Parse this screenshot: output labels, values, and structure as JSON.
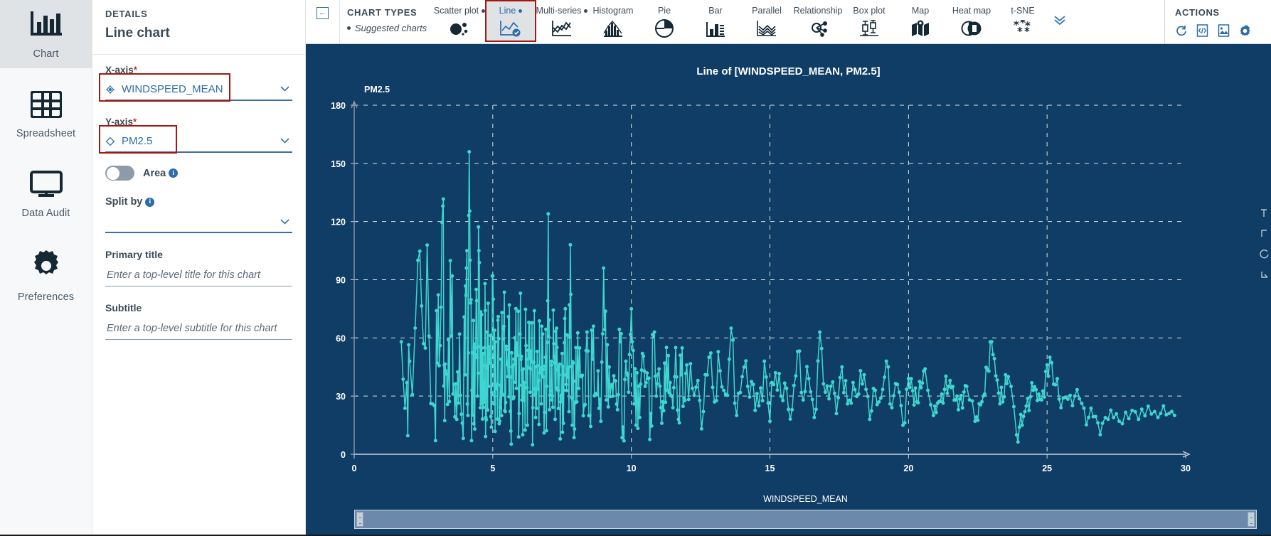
{
  "rail": {
    "items": [
      {
        "label": "Chart",
        "icon": "bar-chart-icon",
        "active": true
      },
      {
        "label": "Spreadsheet",
        "icon": "table-grid-icon",
        "active": false
      },
      {
        "label": "Data Audit",
        "icon": "monitor-icon",
        "active": false
      },
      {
        "label": "Preferences",
        "icon": "gear-icon",
        "active": false
      }
    ]
  },
  "details": {
    "kicker": "DETAILS",
    "title": "Line chart",
    "x_axis": {
      "label": "X-axis",
      "required": "*",
      "value": "WINDSPEED_MEAN",
      "icon": "categorical-field-icon",
      "highlighted": true
    },
    "y_axis": {
      "label": "Y-axis",
      "required": "*",
      "value": "PM2.5",
      "icon": "continuous-field-icon",
      "highlighted": true
    },
    "area_toggle": {
      "label": "Area",
      "state": "off",
      "info": "info-icon"
    },
    "split_by": {
      "label": "Split by",
      "value": "",
      "info": "info-icon"
    },
    "primary_title": {
      "label": "Primary title",
      "value": "",
      "placeholder": "Enter a top-level title for this chart"
    },
    "subtitle": {
      "label": "Subtitle",
      "value": "",
      "placeholder": "Enter a top-level subtitle for this chart"
    }
  },
  "topbar": {
    "collapse_icon": "collapse-panel-icon",
    "chart_types_title": "CHART TYPES",
    "suggested_label": "Suggested charts",
    "overflow_icon": "chevron-double-down-icon",
    "types": [
      {
        "label": "Scatter plot",
        "icon": "scatter-plot-icon",
        "suggested": true,
        "selected": false
      },
      {
        "label": "Line",
        "icon": "line-chart-icon",
        "suggested": true,
        "selected": true
      },
      {
        "label": "Multi-series",
        "icon": "multi-series-icon",
        "suggested": true,
        "selected": false
      },
      {
        "label": "Histogram",
        "icon": "histogram-icon",
        "suggested": false,
        "selected": false
      },
      {
        "label": "Pie",
        "icon": "pie-chart-icon",
        "suggested": false,
        "selected": false
      },
      {
        "label": "Bar",
        "icon": "bar-chart-icon",
        "suggested": false,
        "selected": false
      },
      {
        "label": "Parallel",
        "icon": "parallel-icon",
        "suggested": false,
        "selected": false
      },
      {
        "label": "Relationship",
        "icon": "relationship-icon",
        "suggested": false,
        "selected": false
      },
      {
        "label": "Box plot",
        "icon": "box-plot-icon",
        "suggested": false,
        "selected": false
      },
      {
        "label": "Map",
        "icon": "map-icon",
        "suggested": false,
        "selected": false
      },
      {
        "label": "Heat map",
        "icon": "heat-map-icon",
        "suggested": false,
        "selected": false
      },
      {
        "label": "t-SNE",
        "icon": "tsne-icon",
        "suggested": false,
        "selected": false
      }
    ],
    "actions": {
      "title": "ACTIONS",
      "icons": [
        {
          "name": "refresh-icon"
        },
        {
          "name": "export-code-icon"
        },
        {
          "name": "export-image-icon"
        },
        {
          "name": "settings-gear-icon"
        }
      ]
    }
  },
  "colors": {
    "chart_background": "#103d65",
    "series": "#3dd6d0",
    "accent_blue": "#2d6ca8",
    "highlight_red": "#a5160f",
    "rail_active": "#dfe3e6"
  },
  "chart_data": {
    "type": "line",
    "title": "Line of [WINDSPEED_MEAN, PM2.5]",
    "xlabel": "WINDSPEED_MEAN",
    "ylabel": "PM2.5",
    "xlim": [
      0,
      30
    ],
    "ylim": [
      0,
      180
    ],
    "xticks": [
      0,
      5,
      10,
      15,
      20,
      25,
      30
    ],
    "yticks": [
      0,
      30,
      60,
      90,
      120,
      150,
      180
    ],
    "grid": true,
    "legend": "none",
    "marker": "circle",
    "series": [
      {
        "name": "PM2.5",
        "color": "#3dd6d0",
        "points": [
          [
            1.7,
            58
          ],
          [
            1.9,
            37
          ],
          [
            2.0,
            48
          ],
          [
            2.3,
            100
          ],
          [
            2.5,
            57
          ],
          [
            2.7,
            61
          ],
          [
            2.9,
            25
          ],
          [
            3.0,
            47
          ],
          [
            3.1,
            56
          ],
          [
            3.2,
            128
          ],
          [
            3.25,
            46
          ],
          [
            3.3,
            43
          ],
          [
            3.4,
            59
          ],
          [
            3.5,
            61
          ],
          [
            3.6,
            36
          ],
          [
            3.7,
            18
          ],
          [
            3.8,
            62
          ],
          [
            3.9,
            16
          ],
          [
            4.0,
            41
          ],
          [
            4.05,
            96
          ],
          [
            4.1,
            20
          ],
          [
            4.15,
            156
          ],
          [
            4.2,
            78
          ],
          [
            4.25,
            33
          ],
          [
            4.3,
            69
          ],
          [
            4.35,
            13
          ],
          [
            4.4,
            85
          ],
          [
            4.45,
            30
          ],
          [
            4.5,
            105
          ],
          [
            4.55,
            24
          ],
          [
            4.6,
            72
          ],
          [
            4.62,
            38
          ],
          [
            4.65,
            52
          ],
          [
            4.7,
            27
          ],
          [
            4.72,
            88
          ],
          [
            4.75,
            19
          ],
          [
            4.8,
            63
          ],
          [
            4.85,
            35
          ],
          [
            4.9,
            47
          ],
          [
            4.95,
            14
          ],
          [
            5.0,
            92
          ],
          [
            5.05,
            26
          ],
          [
            5.1,
            58
          ],
          [
            5.15,
            36
          ],
          [
            5.2,
            71
          ],
          [
            5.25,
            17
          ],
          [
            5.3,
            49
          ],
          [
            5.35,
            31
          ],
          [
            5.4,
            66
          ],
          [
            5.45,
            22
          ],
          [
            5.5,
            54
          ],
          [
            5.55,
            40
          ],
          [
            5.6,
            77
          ],
          [
            5.65,
            12
          ],
          [
            5.7,
            45
          ],
          [
            5.75,
            29
          ],
          [
            5.8,
            60
          ],
          [
            5.85,
            34
          ],
          [
            5.9,
            51
          ],
          [
            5.95,
            21
          ],
          [
            6.0,
            83
          ],
          [
            6.05,
            28
          ],
          [
            6.1,
            44
          ],
          [
            6.15,
            37
          ],
          [
            6.2,
            56
          ],
          [
            6.25,
            15
          ],
          [
            6.3,
            68
          ],
          [
            6.35,
            32
          ],
          [
            6.4,
            48
          ],
          [
            6.45,
            24
          ],
          [
            6.5,
            74
          ],
          [
            6.55,
            19
          ],
          [
            6.6,
            53
          ],
          [
            6.65,
            38
          ],
          [
            6.7,
            42
          ],
          [
            6.75,
            26
          ],
          [
            6.8,
            62
          ],
          [
            6.85,
            11
          ],
          [
            6.9,
            50
          ],
          [
            6.95,
            35
          ],
          [
            7.0,
            124
          ],
          [
            7.05,
            23
          ],
          [
            7.1,
            46
          ],
          [
            7.15,
            30
          ],
          [
            7.2,
            57
          ],
          [
            7.25,
            18
          ],
          [
            7.3,
            65
          ],
          [
            7.35,
            33
          ],
          [
            7.4,
            41
          ],
          [
            7.45,
            27
          ],
          [
            7.5,
            52
          ],
          [
            7.55,
            16
          ],
          [
            7.6,
            70
          ],
          [
            7.65,
            36
          ],
          [
            7.7,
            44
          ],
          [
            7.75,
            22
          ],
          [
            7.8,
            108
          ],
          [
            7.85,
            29
          ],
          [
            7.9,
            47
          ],
          [
            7.95,
            13
          ],
          [
            8.0,
            55
          ],
          [
            8.1,
            34
          ],
          [
            8.2,
            40
          ],
          [
            8.3,
            25
          ],
          [
            8.4,
            63
          ],
          [
            8.5,
            20
          ],
          [
            8.6,
            49
          ],
          [
            8.7,
            31
          ],
          [
            8.8,
            43
          ],
          [
            8.9,
            17
          ],
          [
            9.0,
            96
          ],
          [
            9.1,
            28
          ],
          [
            9.2,
            45
          ],
          [
            9.3,
            36
          ],
          [
            9.4,
            38
          ],
          [
            9.5,
            23
          ],
          [
            9.6,
            58
          ],
          [
            9.7,
            14
          ],
          [
            9.8,
            48
          ],
          [
            9.9,
            32
          ],
          [
            10.0,
            75
          ],
          [
            10.1,
            26
          ],
          [
            10.2,
            42
          ],
          [
            10.3,
            19
          ],
          [
            10.4,
            52
          ],
          [
            10.5,
            35
          ],
          [
            10.6,
            39
          ],
          [
            10.7,
            21
          ],
          [
            10.8,
            61
          ],
          [
            10.9,
            30
          ],
          [
            11.0,
            44
          ],
          [
            11.1,
            16
          ],
          [
            11.2,
            47
          ],
          [
            11.3,
            33
          ],
          [
            11.4,
            37
          ],
          [
            11.5,
            24
          ],
          [
            11.6,
            55
          ],
          [
            11.7,
            18
          ],
          [
            11.8,
            41
          ],
          [
            11.9,
            29
          ],
          [
            12.0,
            46
          ],
          [
            12.2,
            34
          ],
          [
            12.4,
            38
          ],
          [
            12.6,
            22
          ],
          [
            12.8,
            50
          ],
          [
            13.0,
            27
          ],
          [
            13.2,
            43
          ],
          [
            13.4,
            31
          ],
          [
            13.6,
            65
          ],
          [
            13.8,
            20
          ],
          [
            14.0,
            40
          ],
          [
            14.2,
            35
          ],
          [
            14.4,
            36
          ],
          [
            14.6,
            25
          ],
          [
            14.8,
            48
          ],
          [
            15.0,
            17
          ],
          [
            15.2,
            42
          ],
          [
            15.4,
            30
          ],
          [
            15.6,
            34
          ],
          [
            15.8,
            23
          ],
          [
            16.0,
            53
          ],
          [
            16.2,
            28
          ],
          [
            16.4,
            39
          ],
          [
            16.6,
            19
          ],
          [
            16.8,
            63
          ],
          [
            17.0,
            32
          ],
          [
            17.2,
            35
          ],
          [
            17.4,
            21
          ],
          [
            17.6,
            45
          ],
          [
            17.8,
            26
          ],
          [
            18.0,
            37
          ],
          [
            18.2,
            31
          ],
          [
            18.4,
            41
          ],
          [
            18.6,
            18
          ],
          [
            18.8,
            33
          ],
          [
            19.0,
            29
          ],
          [
            19.2,
            48
          ],
          [
            19.4,
            24
          ],
          [
            19.6,
            36
          ],
          [
            19.8,
            15
          ],
          [
            20.0,
            39
          ],
          [
            20.3,
            27
          ],
          [
            20.6,
            44
          ],
          [
            20.9,
            20
          ],
          [
            21.2,
            31
          ],
          [
            21.5,
            38
          ],
          [
            21.8,
            23
          ],
          [
            22.1,
            35
          ],
          [
            22.4,
            17
          ],
          [
            22.7,
            30
          ],
          [
            23.0,
            58
          ],
          [
            23.3,
            26
          ],
          [
            23.6,
            40
          ],
          [
            23.9,
            10
          ],
          [
            24.2,
            22
          ],
          [
            24.5,
            33
          ],
          [
            24.8,
            28
          ],
          [
            25.1,
            50
          ],
          [
            25.5,
            24
          ],
          [
            26.0,
            30
          ],
          [
            26.5,
            19
          ],
          [
            27.0,
            16
          ],
          [
            27.6,
            17
          ],
          [
            28.3,
            18
          ],
          [
            29.0,
            19
          ],
          [
            29.6,
            20
          ]
        ]
      }
    ]
  }
}
